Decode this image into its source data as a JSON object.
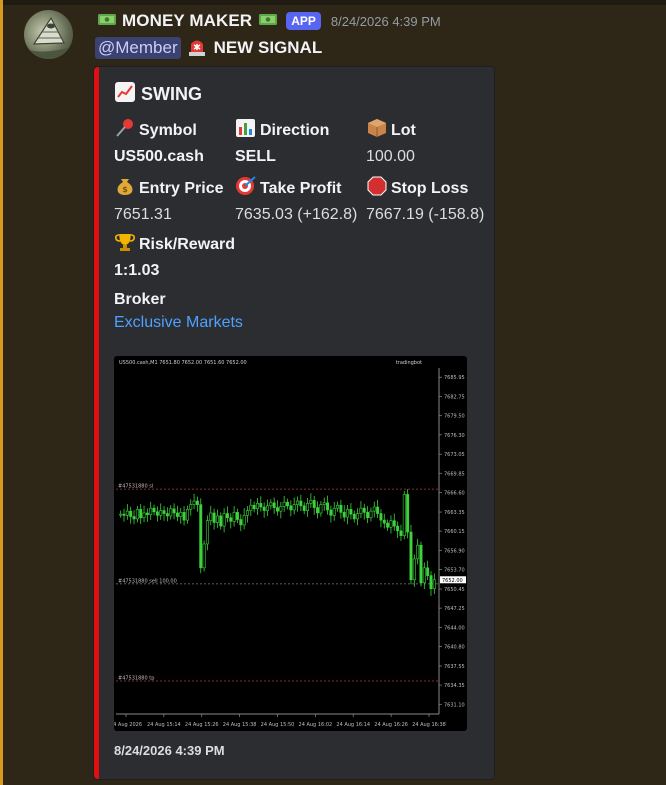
{
  "header": {
    "username": "MONEY MAKER",
    "badge": "APP",
    "timestamp": "8/24/2026 4:39 PM"
  },
  "message": {
    "mention": "@Member",
    "signal_label": "NEW SIGNAL"
  },
  "embed": {
    "title": "SWING",
    "accent_color": "#e10f0f",
    "fields": {
      "symbol": {
        "name": "Symbol",
        "value": "US500.cash"
      },
      "direction": {
        "name": "Direction",
        "value": "SELL"
      },
      "lot": {
        "name": "Lot",
        "value": "100.00"
      },
      "entry": {
        "name": "Entry Price",
        "value": "7651.31"
      },
      "take_profit": {
        "name": "Take Profit",
        "value": "7635.03 (+162.8)"
      },
      "stop_loss": {
        "name": "Stop Loss",
        "value": "7667.19 (-158.8)"
      },
      "risk_reward": {
        "name": "Risk/Reward",
        "value": "1:1.03"
      },
      "broker": {
        "name": "Broker",
        "value": "Exclusive Markets"
      }
    },
    "footer_time": "8/24/2026 4:39 PM"
  },
  "chart_data": {
    "type": "candlestick",
    "header_text": "US500.cash,M1  7651.80 7652.00 7651.60 7652.00",
    "watermark": "tradingbot",
    "y_ticks": [
      "7685.95",
      "7682.75",
      "7679.50",
      "7676.30",
      "7673.05",
      "7669.85",
      "7666.60",
      "7663.35",
      "7660.15",
      "7656.90",
      "7653.70",
      "7650.45",
      "7647.25",
      "7644.00",
      "7640.80",
      "7637.55",
      "7634.35",
      "7631.10"
    ],
    "x_ticks": [
      "24 Aug 2026",
      "24 Aug 15:14",
      "24 Aug 15:26",
      "24 Aug 15:38",
      "24 Aug 15:50",
      "24 Aug 16:02",
      "24 Aug 16:14",
      "24 Aug 16:26",
      "24 Aug 16:38"
    ],
    "levels": {
      "sl": {
        "label": "#47531880 sl",
        "price": 7667.19
      },
      "entry": {
        "label": "#47531880 sell 100.00",
        "price": 7651.31
      },
      "tp": {
        "label": "#47531880 tp",
        "price": 7635.03
      }
    },
    "current_price": "7652.00",
    "ylim": [
      7629.5,
      7687.5
    ],
    "closes": [
      7663.0,
      7662.8,
      7663.5,
      7662.6,
      7662.2,
      7663.8,
      7662.4,
      7663.2,
      7662.9,
      7664.0,
      7663.4,
      7662.8,
      7663.6,
      7663.1,
      7662.7,
      7663.9,
      7663.2,
      7662.6,
      7663.3,
      7662.0,
      7663.8,
      7664.6,
      7665.2,
      7664.6,
      7654.0,
      7658.0,
      7661.9,
      7663.2,
      7661.6,
      7662.7,
      7661.0,
      7663.1,
      7662.4,
      7661.8,
      7663.3,
      7662.1,
      7661.2,
      7662.8,
      7663.6,
      7664.5,
      7663.9,
      7664.8,
      7664.2,
      7663.6,
      7664.4,
      7664.9,
      7664.1,
      7663.5,
      7664.3,
      7665.0,
      7664.4,
      7663.7,
      7664.6,
      7665.2,
      7664.4,
      7663.6,
      7664.8,
      7665.3,
      7664.1,
      7663.2,
      7664.6,
      7664.9,
      7663.7,
      7662.8,
      7664.0,
      7664.5,
      7663.3,
      7662.5,
      7663.8,
      7663.0,
      7662.2,
      7663.1,
      7664.0,
      7663.3,
      7662.4,
      7663.5,
      7664.2,
      7663.1,
      7662.0,
      7661.5,
      7660.8,
      7661.9,
      7661.0,
      7660.2,
      7659.4,
      7666.3,
      7660.0,
      7652.0,
      7655.5,
      7657.8,
      7651.5,
      7654.0,
      7652.7,
      7650.5,
      7652.0
    ]
  }
}
